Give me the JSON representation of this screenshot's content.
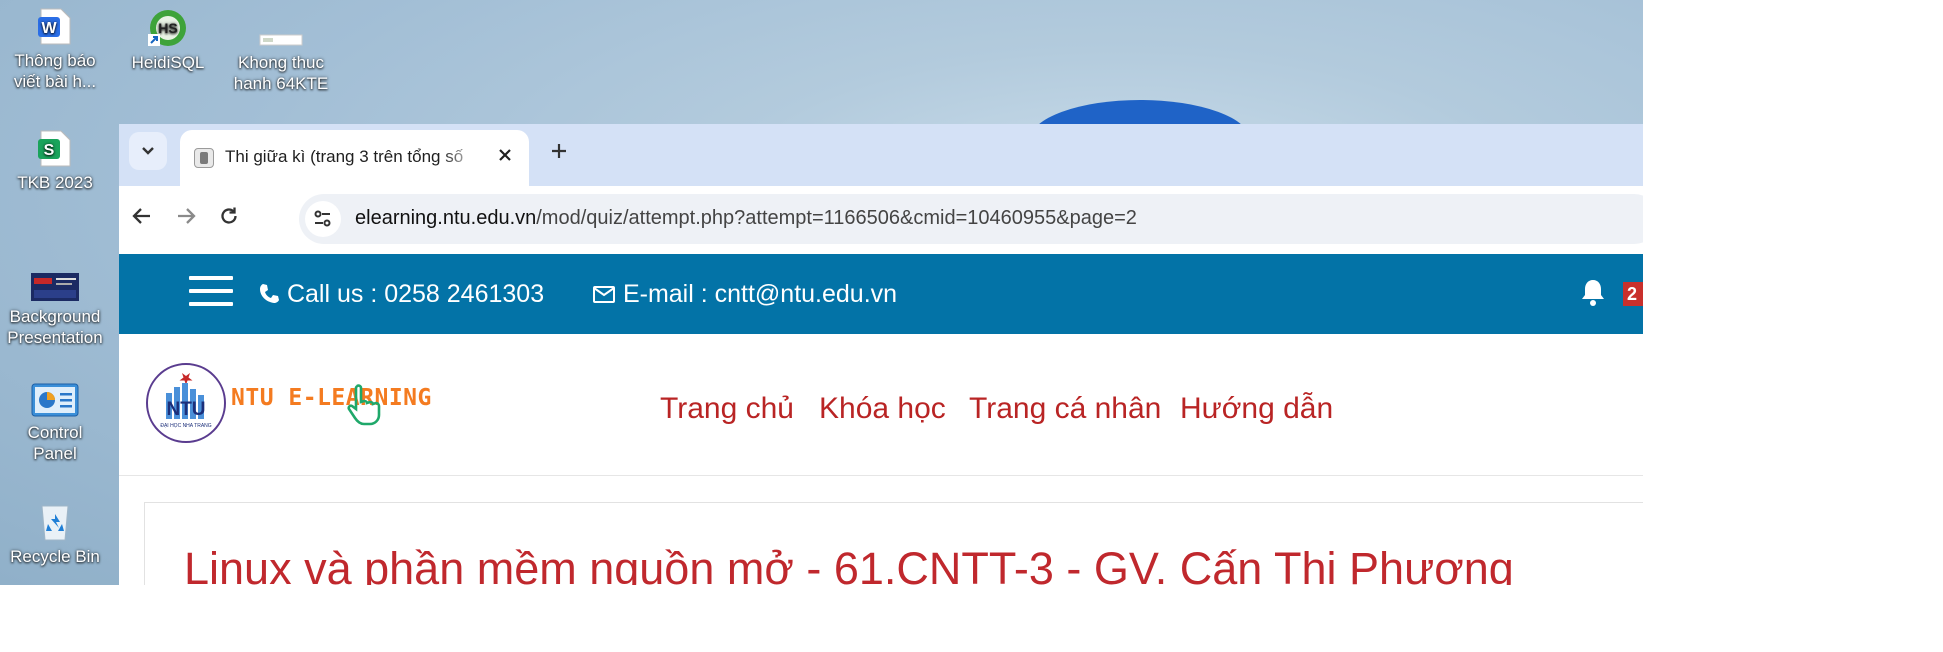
{
  "desktop": {
    "icons": [
      {
        "label_line1": "Thông báo",
        "label_line2": "viết bài h...",
        "icon": "wps-writer-doc-icon"
      },
      {
        "label_line1": "HeidiSQL",
        "label_line2": "",
        "icon": "heidisql-icon"
      },
      {
        "label_line1": "Khong thuc",
        "label_line2": "hanh 64KTE",
        "icon": "image-file-icon"
      },
      {
        "label_line1": "TKB 2023",
        "label_line2": "",
        "icon": "wps-spreadsheet-icon"
      },
      {
        "label_line1": "Background",
        "label_line2": "Presentation",
        "icon": "presentation-thumbnail-icon"
      },
      {
        "label_line1": "Control Panel",
        "label_line2": "",
        "icon": "control-panel-icon"
      },
      {
        "label_line1": "Recycle Bin",
        "label_line2": "",
        "icon": "recycle-bin-icon"
      }
    ]
  },
  "browser": {
    "tab": {
      "title": "Thi giữa kì (trang 3 trên tổng số"
    },
    "url": {
      "host": "elearning.ntu.edu.vn",
      "path": "/mod/quiz/attempt.php?attempt=1166506&cmid=10460955&page=2"
    },
    "icons": {
      "tab_search": "chevron-down-icon",
      "close": "close-icon",
      "new_tab": "plus-icon",
      "back": "back-arrow-icon",
      "forward": "forward-arrow-icon",
      "reload": "reload-icon",
      "site_info": "tune-icon"
    }
  },
  "site": {
    "topbar": {
      "phone_text": "Call us : 0258 2461303",
      "email_text": "E-mail : cntt@ntu.edu.vn",
      "notification_count": "2",
      "colors": {
        "background": "#0373a7"
      }
    },
    "logo": {
      "name": "NTU E-LEARNING",
      "mark_text": "NTU",
      "subtext": "ĐẠI HỌC NHA TRANG"
    },
    "nav": [
      "Trang chủ",
      "Khóa học",
      "Trang cá nhân",
      "Hướng dẫn"
    ],
    "course_title": "Linux và phần mềm nguồn mở - 61.CNTT-3 - GV. Cấn Thị Phương",
    "colors": {
      "nav_link": "#b92424",
      "logo_text": "#f47b20"
    }
  }
}
